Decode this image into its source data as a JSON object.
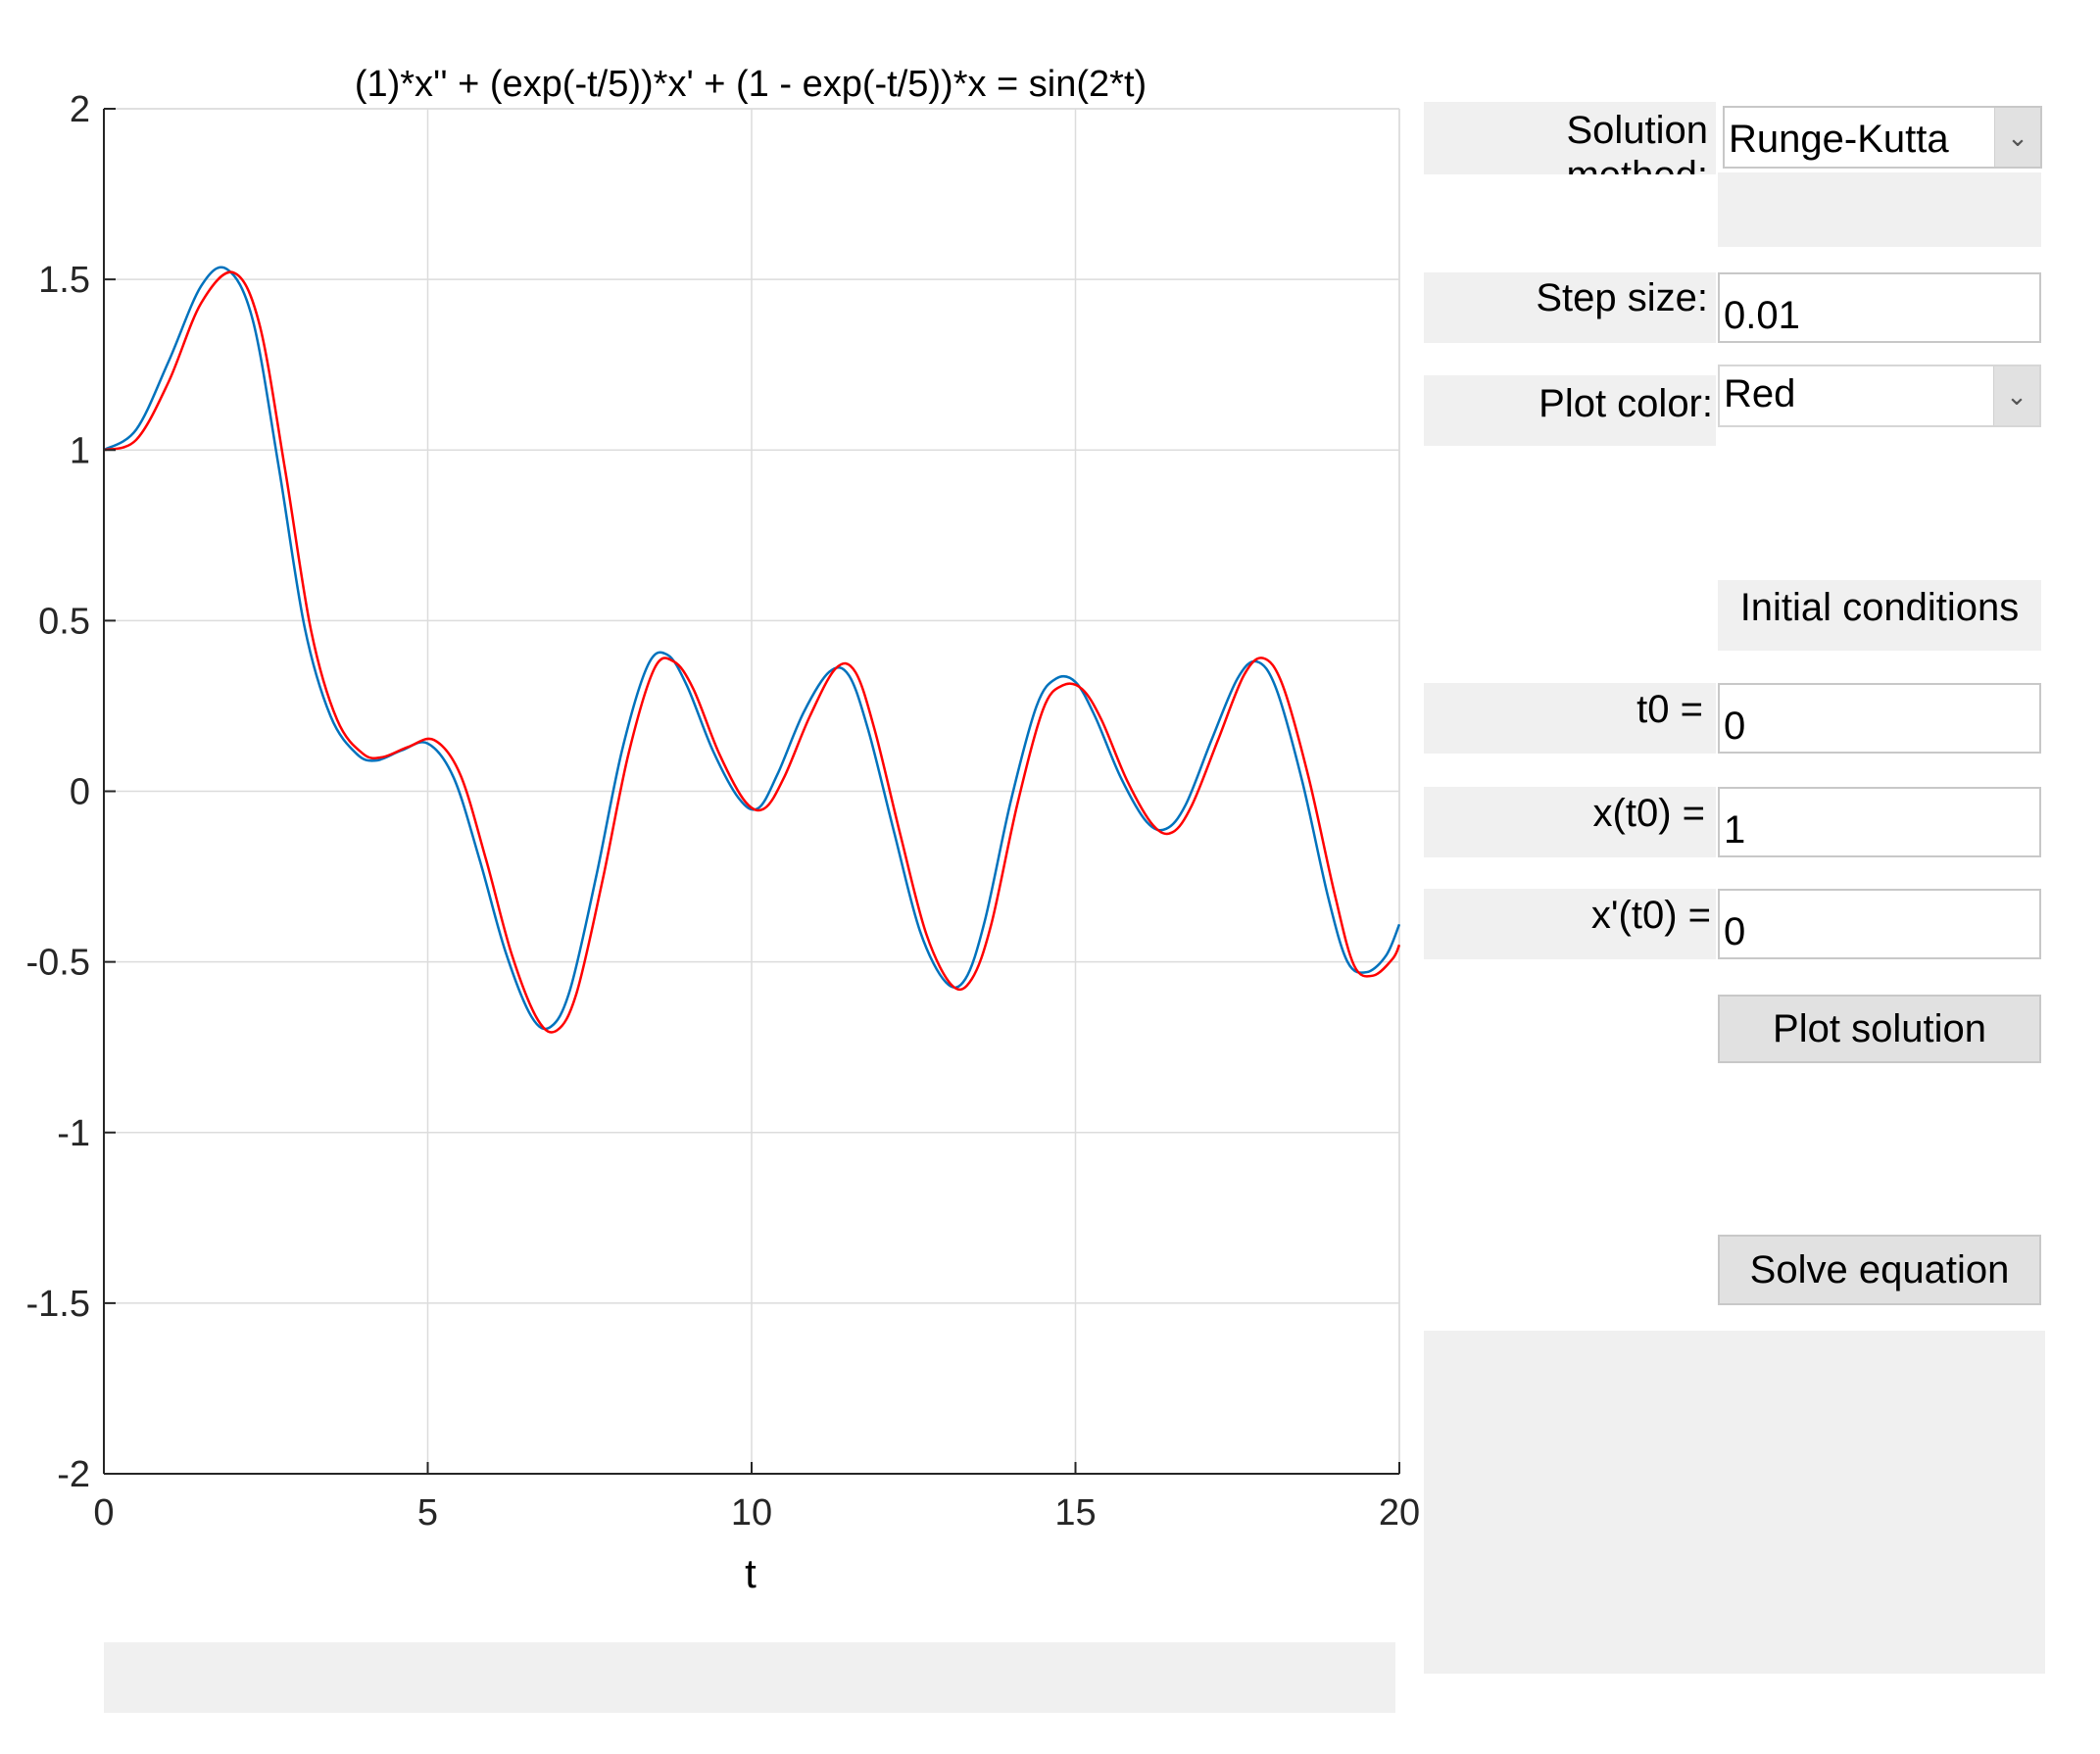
{
  "controls": {
    "solution_method_label": "Solution method:",
    "solution_method_value": "Runge-Kutta",
    "step_size_label": "Step size:",
    "step_size_value": "0.01",
    "plot_color_label": "Plot color:",
    "plot_color_value": "Red",
    "initial_conditions_label": "Initial conditions",
    "t0_label": "t0 =",
    "t0_value": "0",
    "x_t0_label": "x(t0) =",
    "x_t0_value": "1",
    "xp_t0_label": "x'(t0) =",
    "xp_t0_value": "0",
    "plot_solution_button": "Plot solution",
    "solve_equation_button": "Solve equation"
  },
  "colors": {
    "series_red": "#ff0000",
    "series_blue": "#0072bd",
    "panel_gray": "#f0f0f0",
    "grid": "#dcdcdc"
  },
  "chart_data": {
    "type": "line",
    "title": "(1)*x'' + (exp(-t/5))*x' + (1 - exp(-t/5))*x = sin(2*t)",
    "xlabel": "t",
    "ylabel": "",
    "xlim": [
      0,
      20
    ],
    "ylim": [
      -2,
      2
    ],
    "grid": true,
    "x_ticks": [
      "0",
      "5",
      "10",
      "15",
      "20"
    ],
    "y_ticks": [
      "2",
      "1.5",
      "1",
      "0.5",
      "0",
      "-0.5",
      "-1",
      "-1.5",
      "-2"
    ],
    "series": [
      {
        "color": "#0072bd",
        "x": [
          0,
          0.5,
          1.0,
          1.5,
          1.9,
          2.3,
          2.7,
          3.1,
          3.5,
          3.9,
          4.2,
          4.6,
          5.0,
          5.4,
          5.8,
          6.2,
          6.6,
          6.9,
          7.2,
          7.6,
          8.0,
          8.4,
          8.7,
          9.0,
          9.4,
          9.8,
          10.1,
          10.4,
          10.8,
          11.2,
          11.5,
          11.8,
          12.2,
          12.6,
          13.0,
          13.3,
          13.6,
          14.0,
          14.4,
          14.7,
          15.0,
          15.3,
          15.7,
          16.1,
          16.4,
          16.7,
          17.1,
          17.5,
          17.8,
          18.1,
          18.5,
          18.9,
          19.2,
          19.5,
          19.8,
          20.0
        ],
        "values": [
          1.0,
          1.06,
          1.26,
          1.48,
          1.53,
          1.38,
          0.95,
          0.48,
          0.22,
          0.11,
          0.09,
          0.12,
          0.14,
          0.04,
          -0.2,
          -0.47,
          -0.66,
          -0.69,
          -0.58,
          -0.25,
          0.12,
          0.37,
          0.4,
          0.31,
          0.12,
          -0.02,
          -0.05,
          0.05,
          0.23,
          0.35,
          0.34,
          0.18,
          -0.12,
          -0.41,
          -0.56,
          -0.55,
          -0.38,
          -0.03,
          0.25,
          0.33,
          0.32,
          0.22,
          0.04,
          -0.09,
          -0.11,
          -0.04,
          0.15,
          0.33,
          0.38,
          0.3,
          0.03,
          -0.31,
          -0.5,
          -0.53,
          -0.48,
          -0.39
        ]
      },
      {
        "color": "#ff0000",
        "x": [
          0,
          0.5,
          1.0,
          1.5,
          2.0,
          2.4,
          2.8,
          3.2,
          3.6,
          4.0,
          4.3,
          4.7,
          5.1,
          5.5,
          5.9,
          6.3,
          6.7,
          7.0,
          7.3,
          7.7,
          8.1,
          8.5,
          8.8,
          9.1,
          9.5,
          9.9,
          10.2,
          10.5,
          10.9,
          11.3,
          11.6,
          11.9,
          12.3,
          12.7,
          13.1,
          13.4,
          13.7,
          14.1,
          14.5,
          14.8,
          15.1,
          15.4,
          15.8,
          16.2,
          16.5,
          16.8,
          17.2,
          17.6,
          17.9,
          18.2,
          18.6,
          19.0,
          19.3,
          19.6,
          19.9,
          20.0
        ],
        "values": [
          1.0,
          1.03,
          1.2,
          1.43,
          1.52,
          1.37,
          0.94,
          0.47,
          0.21,
          0.11,
          0.1,
          0.13,
          0.15,
          0.05,
          -0.2,
          -0.48,
          -0.67,
          -0.7,
          -0.59,
          -0.26,
          0.11,
          0.36,
          0.38,
          0.3,
          0.11,
          -0.03,
          -0.05,
          0.04,
          0.22,
          0.36,
          0.35,
          0.18,
          -0.13,
          -0.42,
          -0.57,
          -0.55,
          -0.39,
          -0.04,
          0.24,
          0.31,
          0.3,
          0.21,
          0.03,
          -0.1,
          -0.12,
          -0.04,
          0.15,
          0.34,
          0.39,
          0.31,
          0.04,
          -0.3,
          -0.51,
          -0.54,
          -0.49,
          -0.45
        ]
      }
    ]
  }
}
